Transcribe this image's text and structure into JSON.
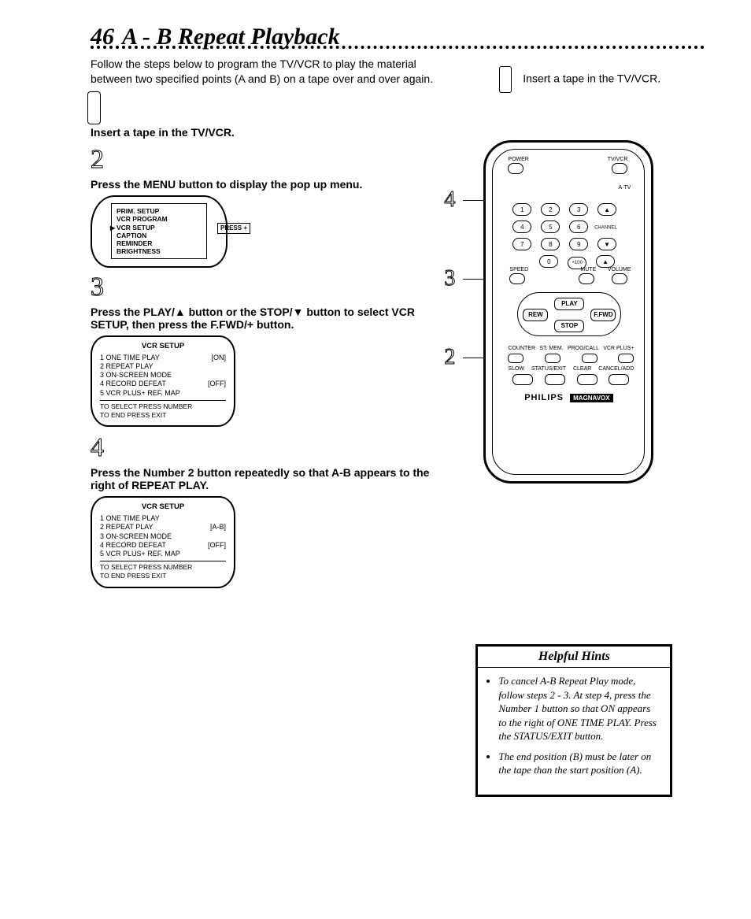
{
  "page_number": "46",
  "title": "A - B Repeat Playback",
  "intro": "Follow the steps below to program the TV/VCR to play the material between two specified points (A and B) on a tape over and over again.",
  "side_step1": "Insert a tape in the TV/VCR.",
  "steps": {
    "s1": {
      "num": "1",
      "text": "Insert a tape in the TV/VCR."
    },
    "s2": {
      "num": "2",
      "text": "Press the MENU button to display the pop up menu."
    },
    "s3": {
      "num": "3",
      "text": "Press the PLAY/▲ button or the STOP/▼ button to select VCR SETUP, then press the F.FWD/+ button."
    },
    "s4": {
      "num": "4",
      "text": "Press the Number 2 button repeatedly so that A-B appears to the right of REPEAT PLAY."
    }
  },
  "menu": {
    "items": [
      "PRIM. SETUP",
      "VCR PROGRAM",
      "VCR SETUP",
      "CAPTION",
      "REMINDER",
      "BRIGHTNESS"
    ],
    "press": "PRESS +"
  },
  "vcr_setup_a": {
    "heading": "VCR SETUP",
    "rows": [
      {
        "n": "1",
        "l": "ONE TIME PLAY",
        "v": "[ON]"
      },
      {
        "n": "2",
        "l": "REPEAT PLAY",
        "v": ""
      },
      {
        "n": "3",
        "l": "ON-SCREEN MODE",
        "v": ""
      },
      {
        "n": "4",
        "l": "RECORD DEFEAT",
        "v": "[OFF]"
      },
      {
        "n": "5",
        "l": "VCR PLUS+ REF. MAP",
        "v": ""
      }
    ],
    "footer1": "TO SELECT PRESS NUMBER",
    "footer2": "TO END PRESS EXIT"
  },
  "vcr_setup_b": {
    "heading": "VCR SETUP",
    "rows": [
      {
        "n": "1",
        "l": "ONE TIME PLAY",
        "v": ""
      },
      {
        "n": "2",
        "l": "REPEAT PLAY",
        "v": "[A-B]"
      },
      {
        "n": "3",
        "l": "ON-SCREEN MODE",
        "v": ""
      },
      {
        "n": "4",
        "l": "RECORD DEFEAT",
        "v": "[OFF]"
      },
      {
        "n": "5",
        "l": "VCR PLUS+ REF. MAP",
        "v": ""
      }
    ],
    "footer1": "TO SELECT PRESS NUMBER",
    "footer2": "TO END PRESS EXIT"
  },
  "remote": {
    "brand": "PHILIPS",
    "sub": "MAGNAVOX",
    "labels": {
      "power": "POWER",
      "tvvcr": "TV/VCR",
      "atv": "A·TV",
      "channel": "CHANNEL",
      "volume": "VOLUME",
      "speed": "SPEED",
      "mute": "MUTE"
    },
    "keys": [
      "1",
      "2",
      "3",
      "4",
      "5",
      "6",
      "7",
      "8",
      "9",
      "0",
      "+100"
    ],
    "play": "PLAY",
    "stop": "STOP",
    "rew": "REW",
    "ffwd": "F.FWD",
    "row_labels": [
      "COUNTER",
      "ST. MEM.",
      "PROG/CALL",
      "VCR PLUS+"
    ],
    "row2_labels": [
      "SLOW",
      "STATUS/EXIT",
      "CLEAR",
      "CANCEL/ADD"
    ],
    "callouts": {
      "c2": "2",
      "c3": "3",
      "c4": "4"
    }
  },
  "hints": {
    "title": "Helpful Hints",
    "items": [
      "To cancel A-B Repeat Play mode, follow steps 2 - 3. At step 4, press the Number 1 button so that ON appears to the right of ONE TIME PLAY. Press the STATUS/EXIT button.",
      "The end position (B) must be later on the tape than the start position (A)."
    ]
  }
}
